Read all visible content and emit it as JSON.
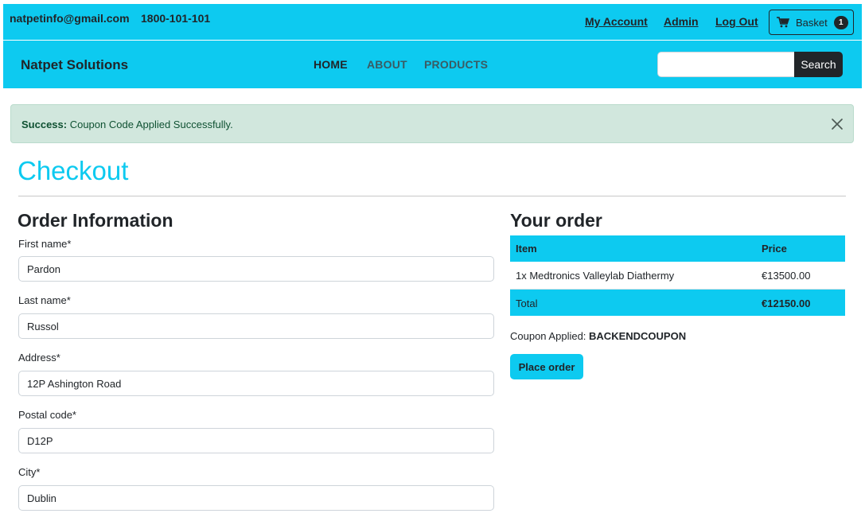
{
  "topbar": {
    "email": "natpetinfo@gmail.com",
    "phone": "1800-101-101",
    "links": {
      "account": "My Account",
      "admin": "Admin",
      "logout": "Log Out"
    },
    "basket": {
      "icon": "cart-icon",
      "label": "Basket",
      "count": "1"
    }
  },
  "navbar": {
    "brand": "Natpet Solutions",
    "links": [
      "HOME",
      "ABOUT",
      "PRODUCTS"
    ],
    "active": "HOME",
    "search": {
      "placeholder": "",
      "value": "",
      "button_label": "Search"
    }
  },
  "alert": {
    "strong": "Success:",
    "message": " Coupon Code Applied Successfully.",
    "close_icon": "close-icon"
  },
  "page": {
    "title": "Checkout"
  },
  "order_form": {
    "title": "Order Information",
    "fields": [
      {
        "label": "First name*",
        "value": "Pardon"
      },
      {
        "label": "Last name*",
        "value": "Russol"
      },
      {
        "label": "Address*",
        "value": "12P Ashington Road"
      },
      {
        "label": "Postal code*",
        "value": "D12P"
      },
      {
        "label": "City*",
        "value": "Dublin"
      }
    ]
  },
  "your_order": {
    "title": "Your order",
    "headers": {
      "item": "Item",
      "price": "Price"
    },
    "rows": [
      {
        "item": "1x Medtronics Valleylab Diathermy",
        "price": "€13500.00"
      }
    ],
    "total": {
      "label": "Total",
      "value": "€12150.00"
    },
    "coupon": {
      "label": "Coupon Applied: ",
      "code": "BACKENDCOUPON"
    },
    "place_order_label": "Place order"
  },
  "colors": {
    "accent": "#0dcaf0",
    "dark": "#212529",
    "success_bg": "#d1e7dd",
    "success_text": "#0f5132"
  }
}
